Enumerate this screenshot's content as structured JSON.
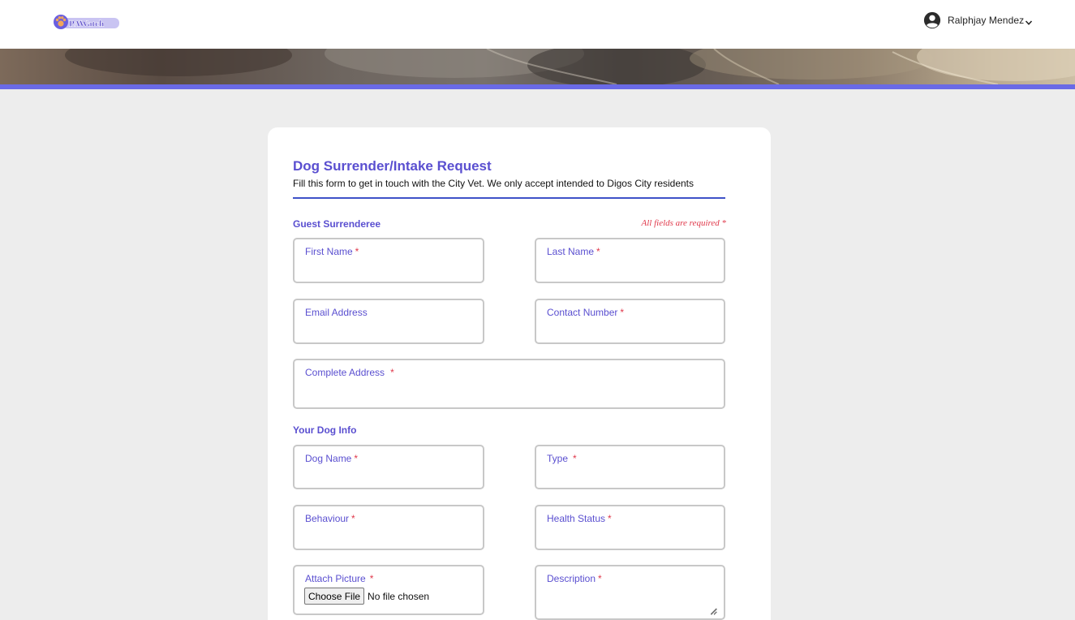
{
  "navbar": {
    "logo_text": "PAWatch",
    "user_name": "Ralphjay Mendez"
  },
  "form": {
    "title": "Dog Surrender/Intake Request",
    "subtitle": "Fill this form to get in touch with the City Vet. We only accept intended to Digos City residents",
    "required_note": "All fields are required *",
    "guest_section": {
      "title": "Guest Surrenderee",
      "first_name": {
        "label": "First Name",
        "required_mark": "*",
        "value": ""
      },
      "last_name": {
        "label": "Last Name",
        "required_mark": "*",
        "value": ""
      },
      "email": {
        "label": "Email Address",
        "value": ""
      },
      "contact_number": {
        "label": "Contact Number",
        "required_mark": "*",
        "value": ""
      },
      "complete_address": {
        "label": "Complete Address",
        "required_mark": "*",
        "value": ""
      }
    },
    "dog_section": {
      "title": "Your Dog Info",
      "dog_name": {
        "label": "Dog Name",
        "required_mark": "*",
        "value": ""
      },
      "type": {
        "label": "Type",
        "required_mark": "*",
        "value": ""
      },
      "behaviour": {
        "label": "Behaviour",
        "required_mark": "*",
        "value": ""
      },
      "health_status": {
        "label": "Health Status",
        "required_mark": "*",
        "value": ""
      },
      "attach_picture": {
        "label": "Attach Picture",
        "required_mark": "*",
        "button_label": "Choose File",
        "status_text": "No file chosen"
      },
      "description": {
        "label": "Description",
        "required_mark": "*",
        "value": ""
      }
    }
  },
  "colors": {
    "accent": "#5a4fd0",
    "accent_bar": "#6a6ae6",
    "required": "#e0394b",
    "page_background": "#ededed",
    "field_border": "#c8c8c8"
  },
  "icons": {
    "logo": "paw-logo-icon",
    "user": "user-circle-icon",
    "dropdown": "chevron-down-icon",
    "resize": "resize-grip-icon"
  }
}
